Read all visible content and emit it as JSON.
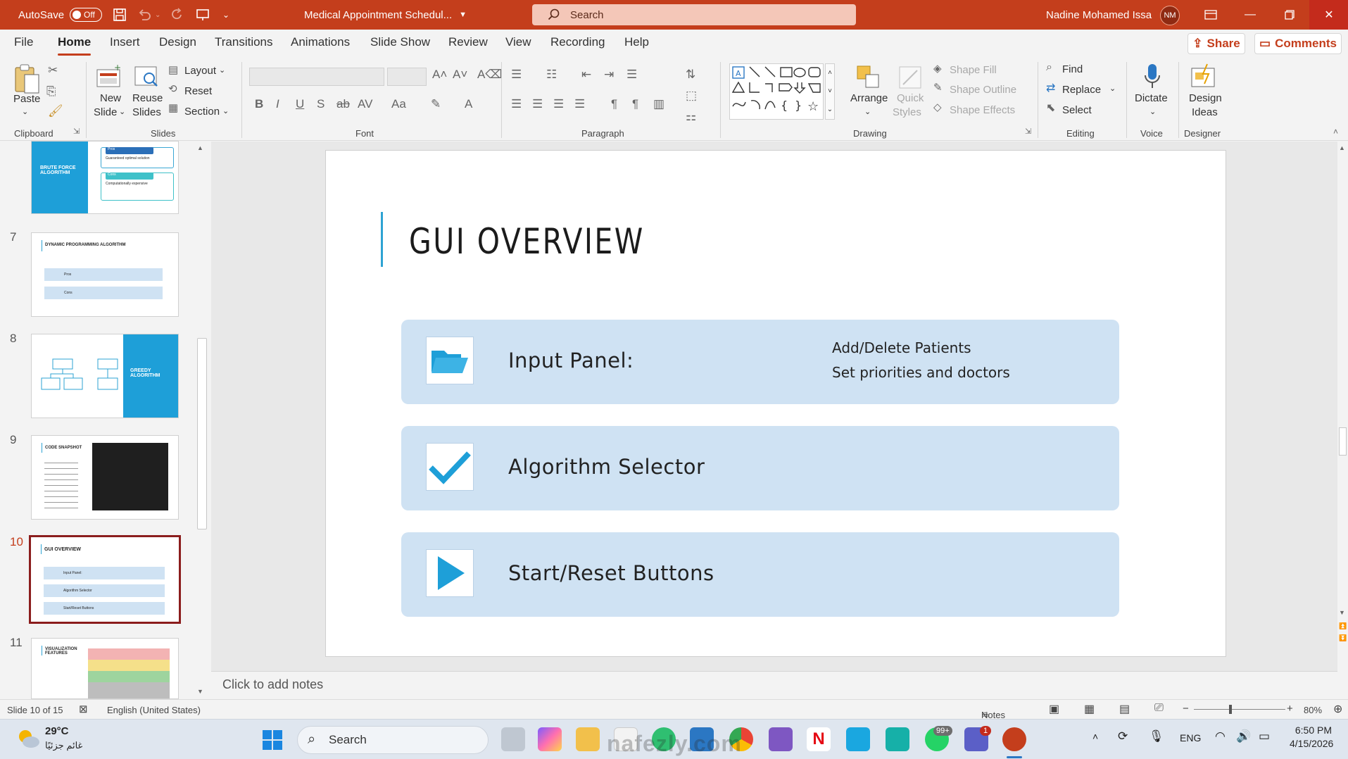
{
  "titlebar": {
    "autosave_label": "AutoSave",
    "autosave_state": "Off",
    "doc_title": "Medical Appointment Schedul...",
    "search_placeholder": "Search",
    "user_name": "Nadine Mohamed Issa",
    "user_initials": "NM"
  },
  "menu": {
    "tabs": [
      "File",
      "Home",
      "Insert",
      "Design",
      "Transitions",
      "Animations",
      "Slide Show",
      "Review",
      "View",
      "Recording",
      "Help"
    ],
    "active": "Home",
    "share_label": "Share",
    "comments_label": "Comments"
  },
  "ribbon": {
    "clipboard": {
      "paste": "Paste",
      "group": "Clipboard"
    },
    "slides": {
      "new_slide_1": "New",
      "new_slide_2": "Slide",
      "reuse_1": "Reuse",
      "reuse_2": "Slides",
      "layout": "Layout",
      "reset": "Reset",
      "section": "Section",
      "group": "Slides"
    },
    "font": {
      "group": "Font"
    },
    "paragraph": {
      "group": "Paragraph"
    },
    "drawing": {
      "arrange": "Arrange",
      "quick_styles_1": "Quick",
      "quick_styles_2": "Styles",
      "shape_fill": "Shape Fill",
      "shape_outline": "Shape Outline",
      "shape_effects": "Shape Effects",
      "group": "Drawing"
    },
    "editing": {
      "find": "Find",
      "replace": "Replace",
      "select": "Select",
      "group": "Editing"
    },
    "voice": {
      "dictate": "Dictate",
      "group": "Voice"
    },
    "designer": {
      "design_ideas_1": "Design",
      "design_ideas_2": "Ideas",
      "group": "Designer"
    }
  },
  "thumbnails": [
    {
      "number": "",
      "title": "BRUTE FORCE ALGORITHM",
      "pros": "Pros",
      "pros_text": "Guaranteed optimal solution",
      "cons": "Cons",
      "cons_text": "Computationally expensive"
    },
    {
      "number": "7",
      "title": "DYNAMIC PROGRAMMING ALGORITHM",
      "row1": "Pros",
      "row2": "Cons"
    },
    {
      "number": "8",
      "title": "GREEDY ALGORITHM"
    },
    {
      "number": "9",
      "title": "CODE SNAPSHOT"
    },
    {
      "number": "10",
      "title": "GUI OVERVIEW",
      "row1": "Input Panel:",
      "row2": "Algorithm Selector",
      "row3": "Start/Reset Buttons"
    },
    {
      "number": "11",
      "title": "VISUALIZATION FEATURES"
    }
  ],
  "slide": {
    "title": "GUI OVERVIEW",
    "cards": [
      {
        "title": "Input Panel:",
        "desc_line1": "Add/Delete Patients",
        "desc_line2": "Set priorities and doctors",
        "icon": "folder-icon"
      },
      {
        "title": "Algorithm Selector",
        "icon": "checkmark-icon"
      },
      {
        "title": "Start/Reset Buttons",
        "icon": "play-icon"
      }
    ]
  },
  "notes_placeholder": "Click to add notes",
  "status": {
    "slide_counter": "Slide 10 of 15",
    "language": "English (United States)",
    "notes": "Notes",
    "zoom": "80%"
  },
  "taskbar": {
    "weather_temp": "29°C",
    "weather_desc": "غائم جزئيًا",
    "search_label": "Search",
    "lang": "ENG",
    "time": "6:50 PM",
    "date": "4/15/2026",
    "whatsapp_badge": "99+",
    "teams_badge": "1",
    "watermark": "nafezly.com"
  },
  "colors": {
    "accent": "#c43e1c",
    "card_bg": "#cfe2f3",
    "icon_blue": "#1e9fd8",
    "slide_accent": "#2ea3d3"
  }
}
